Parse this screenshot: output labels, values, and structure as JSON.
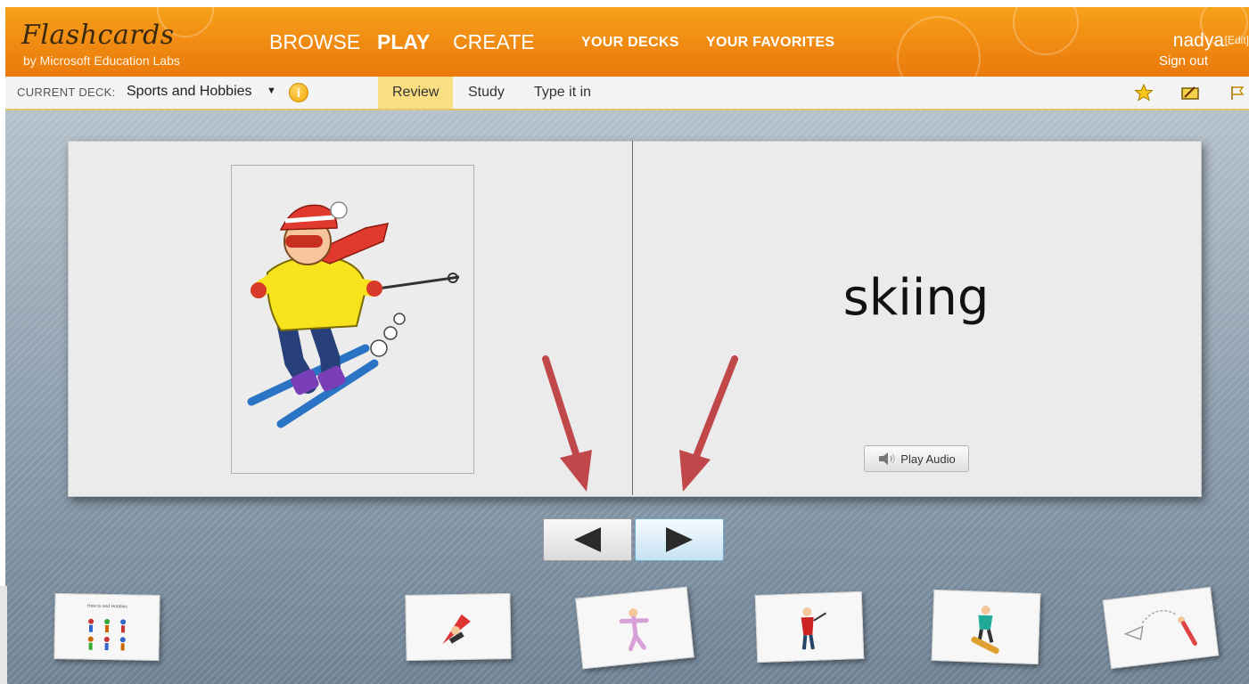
{
  "header": {
    "logo_title": "Flashcards",
    "logo_subtitle": "by Microsoft Education Labs",
    "nav": [
      {
        "label": "BROWSE"
      },
      {
        "label": "PLAY"
      },
      {
        "label": "CREATE"
      }
    ],
    "secondary_nav": [
      {
        "label": "YOUR DECKS"
      },
      {
        "label": "YOUR FAVORITES"
      }
    ],
    "user": {
      "name": "nadya",
      "edit_label": "[Edit]",
      "signout_label": "Sign out"
    }
  },
  "toolbar": {
    "deck_label": "CURRENT DECK:",
    "deck_name": "Sports and Hobbies",
    "deck_caret": "▼",
    "info_glyph": "i",
    "modes": [
      {
        "label": "Review"
      },
      {
        "label": "Study"
      },
      {
        "label": "Type it in"
      }
    ],
    "icons": [
      "favorite-star-icon",
      "edit-icon",
      "flag-icon"
    ]
  },
  "card": {
    "word": "skiing",
    "image": "skier-illustration",
    "audio_button_label": "Play Audio"
  },
  "navigation": {
    "prev_icon": "left-triangle-icon",
    "next_icon": "right-triangle-icon"
  },
  "thumbnails": [
    {
      "icon": "deck-title-card-thumbnail",
      "caption": "How to and Hobbies"
    },
    {
      "icon": "sledding-thumbnail"
    },
    {
      "icon": "skating-thumbnail"
    },
    {
      "icon": "hockey-thumbnail"
    },
    {
      "icon": "snowboarding-thumbnail"
    },
    {
      "icon": "diving-thumbnail"
    }
  ],
  "colors": {
    "header_orange": "#f08a12",
    "active_tab": "#f9df82",
    "annotation_arrow": "#c0484a"
  }
}
